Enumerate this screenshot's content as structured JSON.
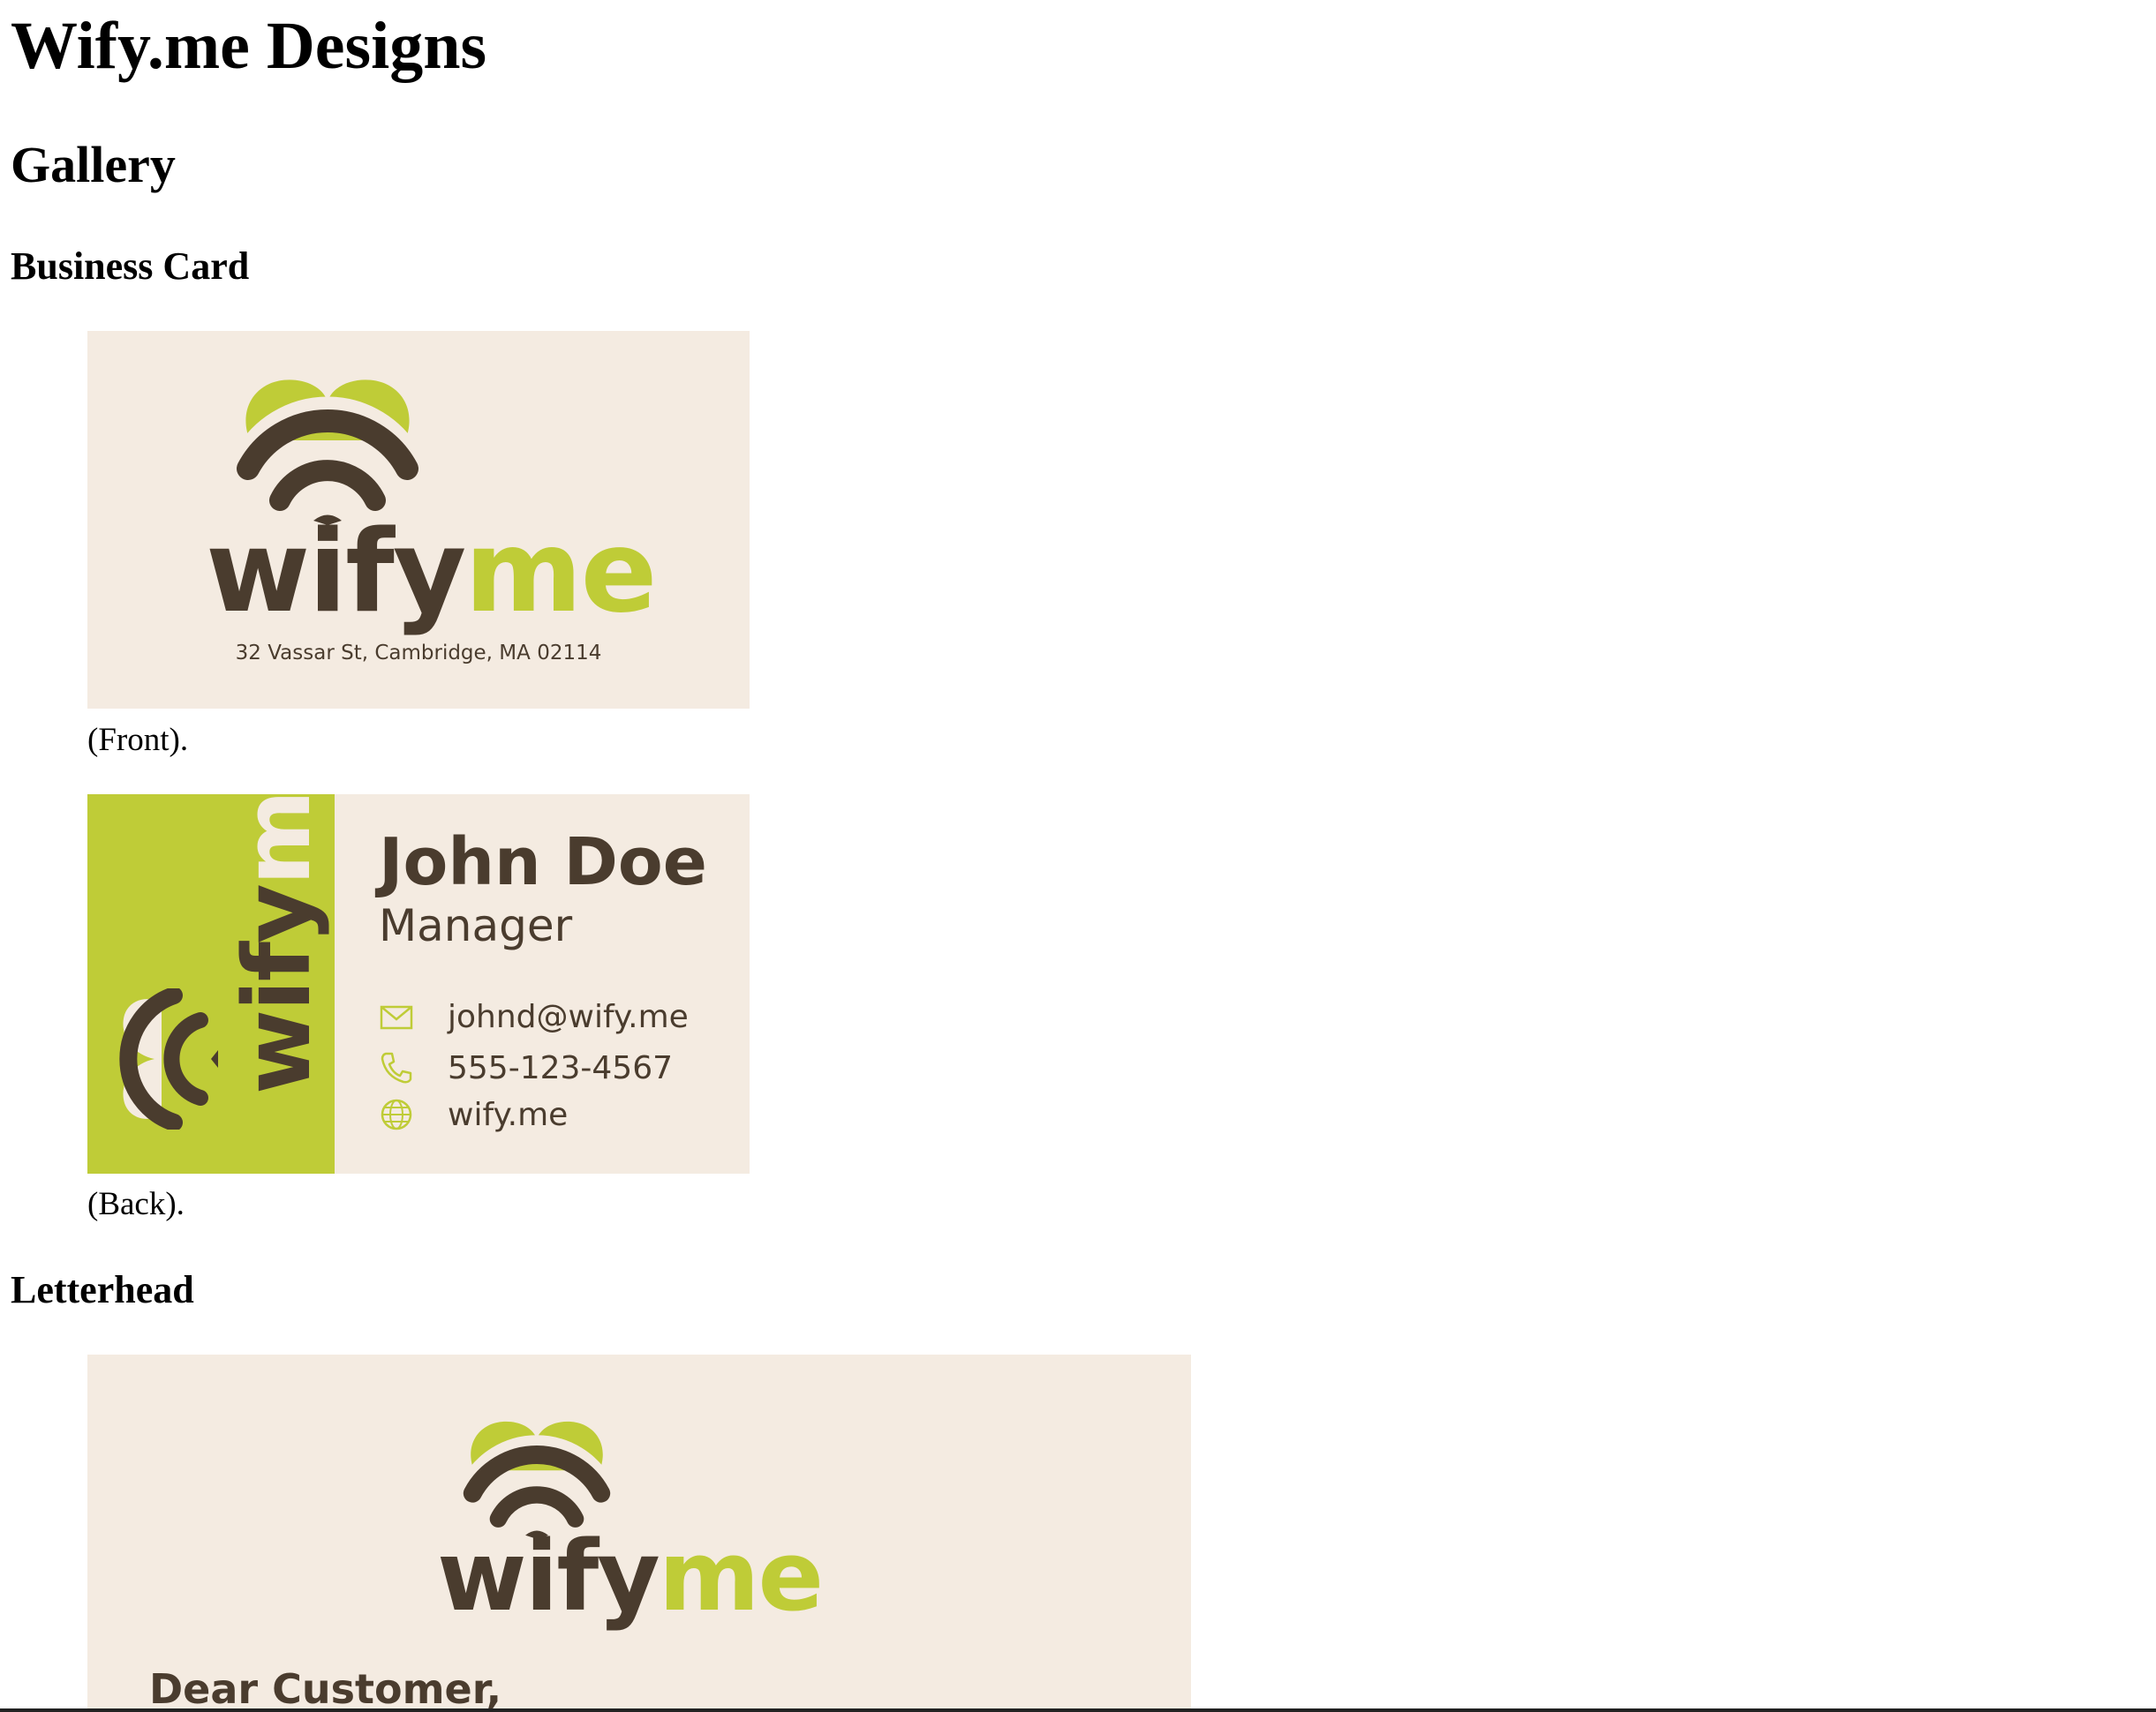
{
  "page": {
    "title": "Wify.me Designs",
    "section": "Gallery"
  },
  "business_card": {
    "heading": "Business Card",
    "front": {
      "brand_part1": "wify",
      "brand_part2": "me",
      "address": "32 Vassar St, Cambridge, MA 02114",
      "caption": "(Front)."
    },
    "back": {
      "brand_part1": "wify",
      "brand_part2": "me",
      "name": "John Doe",
      "title": "Manager",
      "email": "johnd@wify.me",
      "phone": "555-123-4567",
      "website": "wify.me",
      "caption": "(Back)."
    }
  },
  "letterhead": {
    "heading": "Letterhead",
    "brand_part1": "wify",
    "brand_part2": "me",
    "greeting": "Dear Customer,"
  },
  "colors": {
    "brand_green": "#bfcc37",
    "brand_brown": "#4a3c2e",
    "card_background": "#f4ebe1"
  },
  "icons": [
    "heart-wifi-logo-icon",
    "mail-icon",
    "phone-icon",
    "globe-icon"
  ]
}
